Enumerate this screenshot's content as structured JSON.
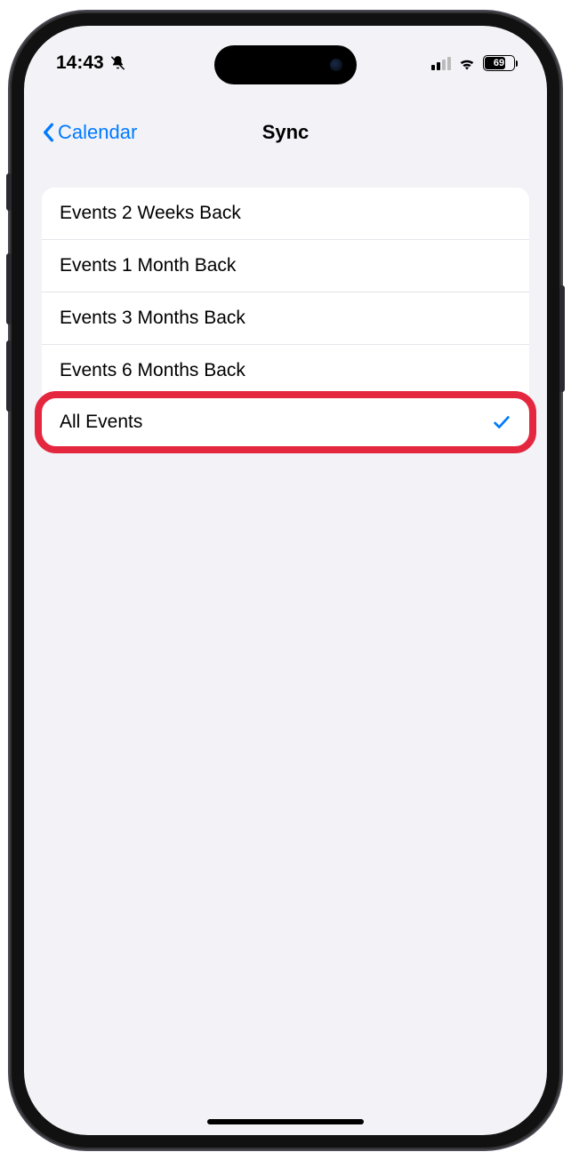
{
  "status": {
    "time": "14:43",
    "battery": "69"
  },
  "nav": {
    "back_label": "Calendar",
    "title": "Sync"
  },
  "options": [
    {
      "label": "Events 2 Weeks Back",
      "selected": false,
      "highlighted": false
    },
    {
      "label": "Events 1 Month Back",
      "selected": false,
      "highlighted": false
    },
    {
      "label": "Events 3 Months Back",
      "selected": false,
      "highlighted": false
    },
    {
      "label": "Events 6 Months Back",
      "selected": false,
      "highlighted": false
    },
    {
      "label": "All Events",
      "selected": true,
      "highlighted": true
    }
  ]
}
